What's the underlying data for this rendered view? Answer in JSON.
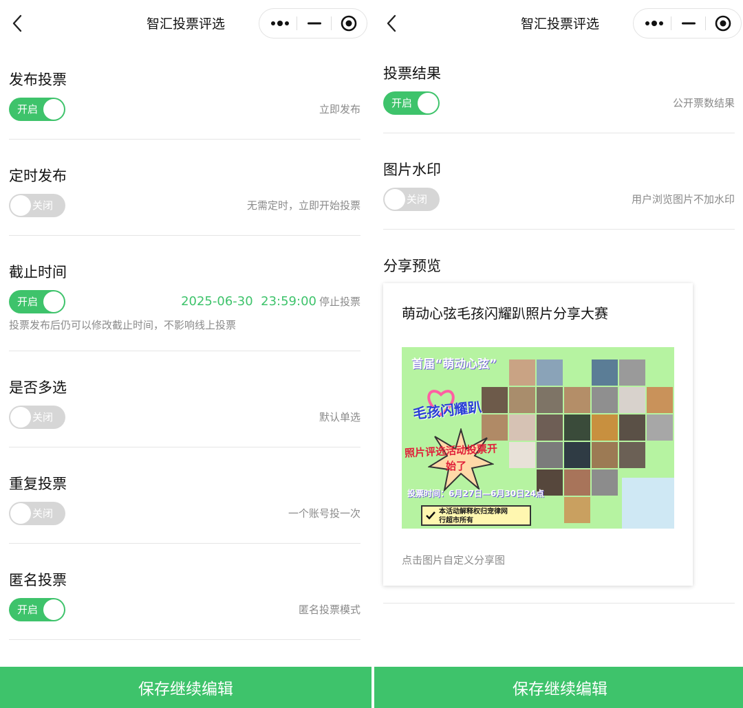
{
  "nav": {
    "title": "智汇投票评选"
  },
  "left": {
    "sections": [
      {
        "title": "发布投票",
        "toggle": "开启",
        "on": true,
        "hint": "立即发布"
      },
      {
        "title": "定时发布",
        "toggle": "关闭",
        "on": false,
        "hint": "无需定时，立即开始投票"
      },
      {
        "title": "截止时间",
        "toggle": "开启",
        "on": true,
        "date": "2025-06-30  23:59:00",
        "hint": "停止投票",
        "note": "投票发布后仍可以修改截止时间，不影响线上投票"
      },
      {
        "title": "是否多选",
        "toggle": "关闭",
        "on": false,
        "hint": "默认单选"
      },
      {
        "title": "重复投票",
        "toggle": "关闭",
        "on": false,
        "hint": "一个账号投一次"
      },
      {
        "title": "匿名投票",
        "toggle": "开启",
        "on": true,
        "hint": "匿名投票模式"
      }
    ]
  },
  "right": {
    "sections": [
      {
        "title": "投票结果",
        "toggle": "开启",
        "on": true,
        "hint": "公开票数结果"
      },
      {
        "title": "图片水印",
        "toggle": "关闭",
        "on": false,
        "hint": "用户浏览图片不加水印"
      }
    ],
    "share": {
      "title": "分享预览",
      "card_title": "萌动心弦毛孩闪耀趴照片分享大赛",
      "hint": "点击图片自定义分享图",
      "poster": {
        "line1": "首届“萌动心弦”",
        "line2": "毛孩闪耀趴",
        "line3": "照片评选活动投票开",
        "line4": "始了",
        "time": "投票时间：6月27日—6月30日24点",
        "notice1": "本活动解释权归宠律网",
        "notice2": "行超市所有"
      }
    }
  },
  "save_label": "保存继续编辑",
  "colors": {
    "accent": "#3ec36b",
    "toggle_off": "#d6d6d6",
    "hint": "#8a8a8a",
    "poster_bg": "#b6f3a1"
  }
}
